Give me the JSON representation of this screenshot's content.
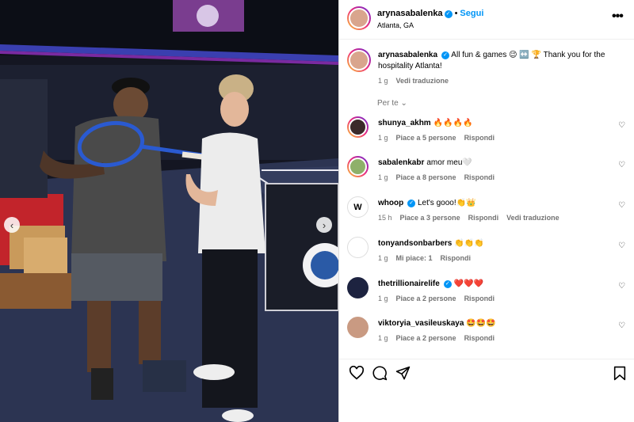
{
  "header": {
    "username": "arynasabalenka",
    "separator": "•",
    "follow_label": "Segui",
    "location": "Atlanta, GA",
    "more_icon": "more-horizontal-icon"
  },
  "caption": {
    "username": "arynasabalenka",
    "text": "All fun & games 😉 ↔️ 🏆 Thank you for the hospitality Atlanta!",
    "time": "1 g",
    "translate_label": "Vedi traduzione"
  },
  "sort_label": "Per te",
  "comments": [
    {
      "username": "shunya_akhm",
      "text": "🔥🔥🔥🔥",
      "time": "1 g",
      "likes": "Piace a 5 persone",
      "reply": "Rispondi",
      "translate": ""
    },
    {
      "username": "sabalenkabr",
      "text": "amor meu🤍",
      "time": "1 g",
      "likes": "Piace a 8 persone",
      "reply": "Rispondi",
      "translate": ""
    },
    {
      "username": "whoop",
      "text": "Let's gooo!👏👑",
      "time": "15 h",
      "likes": "Piace a 3 persone",
      "reply": "Rispondi",
      "translate": "Vedi traduzione"
    },
    {
      "username": "tonyandsonbarbers",
      "text": "👏👏👏",
      "time": "1 g",
      "likes": "Mi piace: 1",
      "reply": "Rispondi",
      "translate": ""
    },
    {
      "username": "thetrillionairelife",
      "text": "❤️❤️❤️",
      "time": "1 g",
      "likes": "Piace a 2 persone",
      "reply": "Rispondi",
      "translate": ""
    },
    {
      "username": "viktoryia_vasileuskaya",
      "text": "🤩🤩🤩",
      "time": "1 g",
      "likes": "Piace a 2 persone",
      "reply": "Rispondi",
      "translate": ""
    }
  ],
  "colors": {
    "accent": "#0095f6",
    "muted": "#737373",
    "court": "#2c3452"
  }
}
